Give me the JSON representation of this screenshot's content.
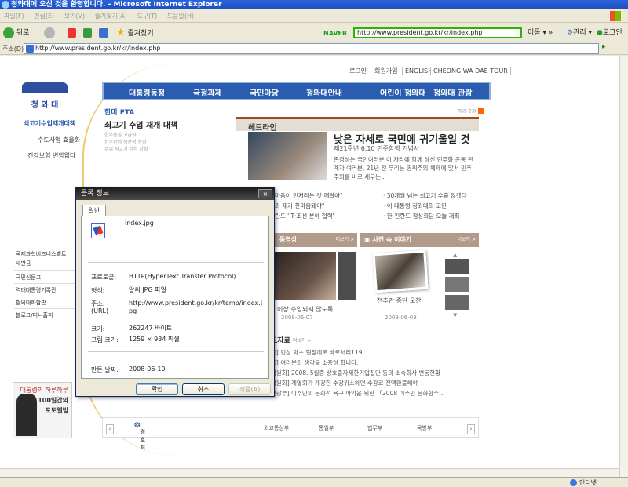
{
  "window": {
    "title": "청와대에 오신 것을 환영합니다. - Microsoft Internet Explorer"
  },
  "menu": [
    "파일(F)",
    "편집(E)",
    "보기(V)",
    "즐겨찾기(A)",
    "도구(T)",
    "도움말(H)"
  ],
  "toolbar": {
    "back_label": "뒤로",
    "favorites_label": "즐겨찾기",
    "naver_label": "NAVER",
    "naver_url": "http://www.president.go.kr/kr/index.php",
    "move_label": "이동",
    "manage_label": "관리",
    "login_label": "로그인"
  },
  "address": {
    "label": "주소(D)",
    "url": "http://www.president.go.kr/kr/index.php"
  },
  "site": {
    "logo_text": "청 와 대",
    "top_links": [
      "로그인",
      "회원가입",
      "ENGLISH",
      "CHEONG WA DAE TOUR"
    ],
    "nav_main": [
      "대통령동정",
      "국정과제",
      "국민마당",
      "청와대안내"
    ],
    "nav_sub": [
      "어린이 청와대",
      "청와대 관람"
    ],
    "left_nav": [
      "쇠고기수입재개대책",
      "수도사업 효율화",
      "건강보험 변함없다"
    ],
    "left_links": [
      "국제과학비즈니스벨트",
      "새만금",
      "국민신문고",
      "역대대통령기록관",
      "협의대화합판",
      "블로그/미니홈피"
    ],
    "fta_kicker": "한미 FTA",
    "fta_headline": "쇠고기 수입 재개 대책",
    "fta_lines": [
      "한우품질 고급화",
      "한우산업 생산성 향상",
      "수입 쇠고기 검역 강화"
    ],
    "rss_label": "RSS 2.0",
    "headline_tab": "헤드라인",
    "news_title": "낮은 자세로 국민에 귀기울일 것",
    "news_date": "제21주년 6.10 민주항쟁 기념사",
    "news_body": "존경하는 국민여러분 이 자리에 함께 하신 민주화 운동 관계자 여러분, 21년 전 우리는 권위주의 체제에 맞서 민주주의를 바로 세우는..",
    "news_items": [
      "마음이 먼저라는 것 깨달아\"",
      "과 제가 한마음돼야\"",
      "란드 'IT·조선 분야 협력'",
      "· 30개월 넘는 쇠고기 수출 않겠다",
      "· 이 대통령 청와대의 고민",
      "· 한-핀란드 정상회담 오늘 개최"
    ],
    "video_tab": "동영상",
    "video_more": "더보기 >",
    "photo_tab": "사진 속 이야기",
    "photo_more": "더보기 >",
    "video_caption": "이상 수입되지 않도록",
    "video_date": "2008-06-07",
    "photo_caption": "천추관 종단 오찬",
    "photo_date": "2008-06-09",
    "docs_title": "도자료",
    "docs_more": "더보기 >",
    "docs_lines": [
      "통] 민상 약초 현장에로 바로처리119",
      "통] 여러분의 생각을 소중히 합니다.",
      "위원회] 2008. 5월중 상호출자제한기업집단 등의 소속회사 변동현황",
      "위원회] 계열회가 개강한 수강위소하면 수강료 전액환불해야",
      "관광부] 이주민의 문화적 욕구 파악을 위한 「2008 이주민 문화향수..."
    ],
    "promo_line1": "대통령의 하루하루",
    "promo_line2": "100일간의",
    "promo_line3": "포토앨범",
    "bottom_logo": "경 호 처",
    "bottom_links": [
      "외교통상부",
      "통일부",
      "법무부",
      "국방부"
    ]
  },
  "dialog": {
    "title": "등록 정보",
    "close_label": "×",
    "tab_label": "일반",
    "filename": "index.jpg",
    "protocol_label": "프로토콜:",
    "protocol_value": "HTTP(HyperText Transfer Protocol)",
    "type_label": "형식:",
    "type_value": "알씨 JPG 파일",
    "address_label": "주소:",
    "address_label2": "(URL)",
    "address_value": "http://www.president.go.kr/kr/temp/index.jpg",
    "size_label": "크기:",
    "size_value": "262247 바이트",
    "dims_label": "그림 크기:",
    "dims_value": "1259 × 934 픽셀",
    "created_label": "만든 날짜:",
    "created_value": "2008-06-10",
    "ok_label": "확인",
    "cancel_label": "취소",
    "apply_label": "적용(A)"
  },
  "status": {
    "zone": "인터넷"
  }
}
